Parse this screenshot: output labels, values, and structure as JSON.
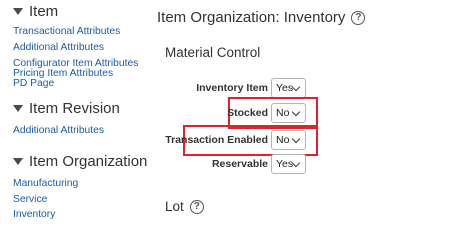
{
  "nav": {
    "item": {
      "title": "Item",
      "links": [
        "Transactional Attributes",
        "Additional Attributes",
        "Configurator Item Attributes",
        "Pricing Item Attributes",
        "PD Page"
      ]
    },
    "item_revision": {
      "title": "Item Revision",
      "links": [
        "Additional Attributes"
      ]
    },
    "item_organization": {
      "title": "Item Organization",
      "links": [
        "Manufacturing",
        "Service",
        "Inventory"
      ]
    }
  },
  "main": {
    "title": "Item Organization: Inventory",
    "help_icon": "question-circle-icon",
    "section_material": "Material Control",
    "fields": [
      {
        "label": "Inventory Item",
        "value": "Yes"
      },
      {
        "label": "Stocked",
        "value": "No"
      },
      {
        "label": "Transaction Enabled",
        "value": "No"
      },
      {
        "label": "Reservable",
        "value": "Yes"
      }
    ],
    "section_lot": "Lot"
  },
  "colors": {
    "link": "#1e5ba8",
    "highlight": "#e0222b"
  }
}
